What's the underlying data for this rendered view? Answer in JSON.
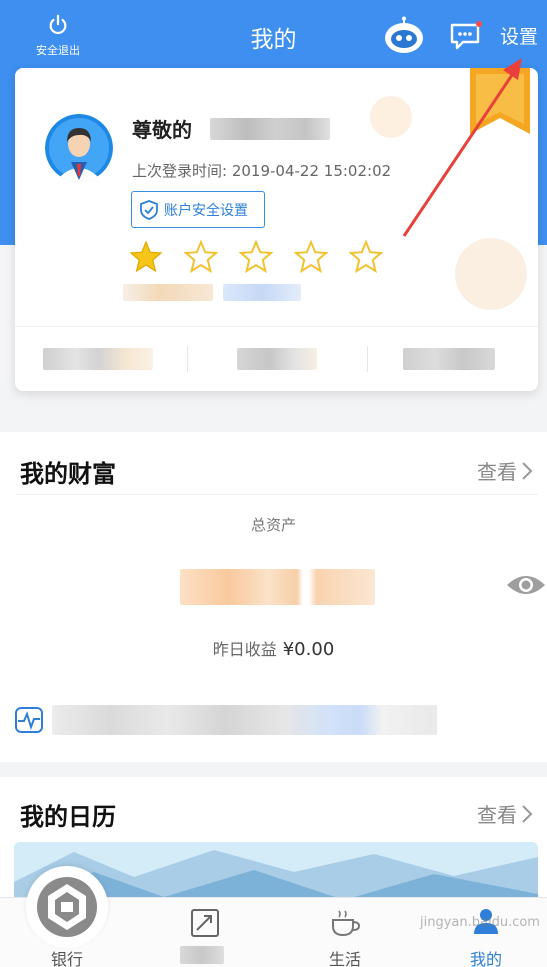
{
  "header": {
    "logout_label": "安全退出",
    "title": "我的",
    "settings_label": "设置"
  },
  "profile": {
    "name_visible": "尊敬的",
    "last_login_label": "上次登录时间:",
    "last_login_time": "2019-04-22 15:02:02",
    "security_button": "账户安全设置",
    "stars_total": 5,
    "stars_filled": 1
  },
  "wealth": {
    "title": "我的财富",
    "view_label": "查看",
    "total_assets_label": "总资产",
    "yesterday_income_label": "昨日收益",
    "yesterday_income_value": "¥0.00"
  },
  "calendar": {
    "title": "我的日历",
    "view_label": "查看"
  },
  "tabs": [
    {
      "label": "银行",
      "icon": "bank-logo-icon",
      "active": false
    },
    {
      "label": "",
      "icon": "trend-icon",
      "active": false
    },
    {
      "label": "生活",
      "icon": "coffee-icon",
      "active": false
    },
    {
      "label": "我的",
      "icon": "user-icon",
      "active": true
    }
  ],
  "watermark": "jingyan.baidu.com",
  "colors": {
    "brand_blue": "#3e8ff0",
    "star_gold": "#f5c518",
    "annotation_red": "#e8403a"
  }
}
